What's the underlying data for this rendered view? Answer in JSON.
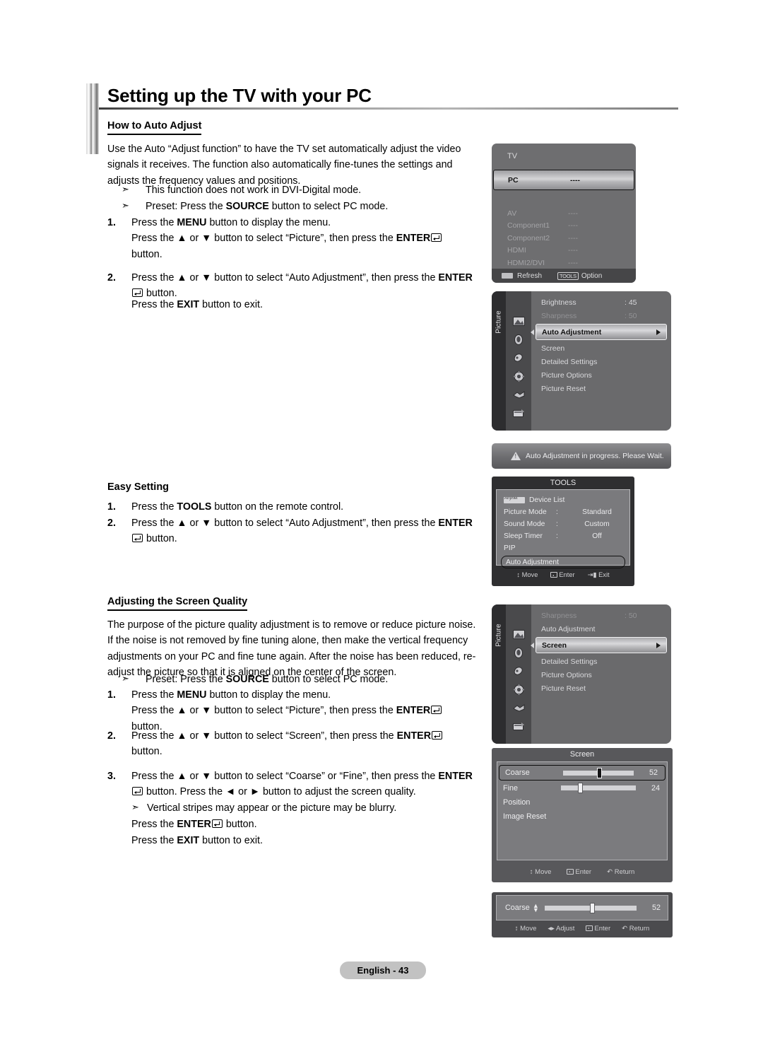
{
  "page": {
    "title": "Setting up the TV with your PC",
    "footer_label": "English - 43"
  },
  "sections": {
    "auto_adjust": {
      "heading": "How to Auto Adjust",
      "intro": "Use the Auto “Adjust function” to have the TV set automatically adjust the video signals it receives. The function also automatically fine-tunes the settings and adjusts the frequency values and positions.",
      "bullet1_marker": "➣",
      "bullet1": "This function does not work in DVI-Digital mode.",
      "bullet2_marker": "➣",
      "bullet2_pre": "Preset: Press the ",
      "bullet2_key": "SOURCE",
      "bullet2_post": " button to select PC mode.",
      "step1_marker": "1.",
      "step1_line1_pre": "Press the ",
      "step1_line1_key": "MENU",
      "step1_line1_post": " button to display the menu.",
      "step1_line2_a": "Press the ▲ or ▼ button to select “Picture”, then press the ",
      "step1_line2_key": "ENTER",
      "step1_line3": "button.",
      "step2_marker": "2.",
      "step2_line1_a": "Press the ▲ or ▼ button to select “Auto Adjustment”, then press the ",
      "step2_line1_key": "ENTER",
      "step2_line2": " button.",
      "step2_line3_pre": "Press the ",
      "step2_line3_key": "EXIT",
      "step2_line3_post": " button to exit."
    },
    "easy_setting": {
      "heading": "Easy Setting",
      "step1_marker": "1.",
      "step1_pre": "Press the ",
      "step1_key": "TOOLS",
      "step1_post": " button on the remote control.",
      "step2_marker": "2.",
      "step2_line1_a": "Press the ▲ or ▼ button to select “Auto Adjustment”, then press the ",
      "step2_line1_key": "ENTER",
      "step2_line2": " button."
    },
    "screen_quality": {
      "heading": "Adjusting the Screen Quality",
      "intro": "The purpose of the picture quality adjustment is to remove or reduce picture noise. If the noise is not removed by fine tuning alone, then make the vertical frequency adjustments on your PC and fine tune again. After the noise has been reduced, re-adjust the picture so that it is aligned on the center of the screen.",
      "bullet1_marker": "➣",
      "bullet1_pre": "Preset: Press the ",
      "bullet1_key": "SOURCE",
      "bullet1_post": " button to select PC mode.",
      "step1_marker": "1.",
      "step1_line1_pre": "Press the ",
      "step1_line1_key": "MENU",
      "step1_line1_post": " button to display the menu.",
      "step1_line2_a": "Press the ▲ or ▼ button to select “Picture”, then press the ",
      "step1_line2_key": "ENTER",
      "step1_line3": "button.",
      "step2_marker": "2.",
      "step2_line1_a": "Press the ▲ or ▼ button to select “Screen”, then press the ",
      "step2_line1_key": "ENTER",
      "step2_line2": "button.",
      "step3_marker": "3.",
      "step3_line1_a": "Press the ▲ or ▼ button to select “Coarse” or “Fine”, then press the ",
      "step3_line1_key": "ENTER",
      "step3_line2": " button. Press the ◄ or ► button to adjust the screen quality.",
      "step3_bullet_marker": "➣",
      "step3_bullet": "Vertical stripes may appear or the picture may be blurry.",
      "step3_line3_pre": "Press the ",
      "step3_line3_key": "ENTER",
      "step3_line3_post": " button.",
      "step3_line4_pre": "Press the ",
      "step3_line4_key": "EXIT",
      "step3_line4_post": " button to exit."
    }
  },
  "osd": {
    "source": {
      "top_label": "TV",
      "selected": {
        "name": "PC",
        "value": "----"
      },
      "items": [
        {
          "name": "AV",
          "value": "----"
        },
        {
          "name": "Component1",
          "value": "----"
        },
        {
          "name": "Component2",
          "value": "----"
        },
        {
          "name": "HDMI",
          "value": "----"
        },
        {
          "name": "HDMI2/DVI",
          "value": "----"
        }
      ],
      "footer": {
        "refresh": "Refresh",
        "tools_tag": "TOOLS",
        "option": "Option"
      }
    },
    "picture_menu_1": {
      "rail_label": "Picture",
      "rows_above": [
        {
          "label": "Brightness",
          "value": ": 45",
          "dim": false
        },
        {
          "label": "Sharpness",
          "value": ": 50",
          "dim": true
        }
      ],
      "highlight": "Auto Adjustment",
      "rows_below": [
        "Screen",
        "Detailed Settings",
        "Picture Options",
        "Picture Reset"
      ]
    },
    "progress_toast": {
      "message": "Auto Adjustment in progress. Please Wait."
    },
    "tools": {
      "title": "TOOLS",
      "device_list_label": "Device List",
      "rows": [
        {
          "label": "Picture Mode",
          "colon": ":",
          "value": "Standard"
        },
        {
          "label": "Sound Mode",
          "colon": ":",
          "value": "Custom"
        },
        {
          "label": "Sleep Timer",
          "colon": ":",
          "value": "Off"
        },
        {
          "label": "PIP",
          "colon": "",
          "value": ""
        }
      ],
      "selected": "Auto Adjustment",
      "footer": {
        "move": "Move",
        "enter": "Enter",
        "exit": "Exit"
      }
    },
    "picture_menu_2": {
      "rail_label": "Picture",
      "rows_above": [
        {
          "label": "Sharpness",
          "value": ": 50",
          "dim": true
        },
        {
          "label": "Auto Adjustment",
          "value": "",
          "dim": false
        }
      ],
      "highlight": "Screen",
      "rows_below": [
        "Detailed Settings",
        "Picture Options",
        "Picture Reset"
      ]
    },
    "screen_submenu": {
      "title": "Screen",
      "coarse": {
        "label": "Coarse",
        "value": "52",
        "percent": 52
      },
      "fine": {
        "label": "Fine",
        "value": "24",
        "percent": 24
      },
      "position_label": "Position",
      "image_reset_label": "Image Reset",
      "footer": {
        "move": "Move",
        "enter": "Enter",
        "return": "Return"
      }
    },
    "coarse_adjust": {
      "label": "Coarse",
      "value": "52",
      "percent": 52,
      "footer": {
        "move": "Move",
        "adjust": "Adjust",
        "enter": "Enter",
        "return": "Return"
      }
    }
  }
}
